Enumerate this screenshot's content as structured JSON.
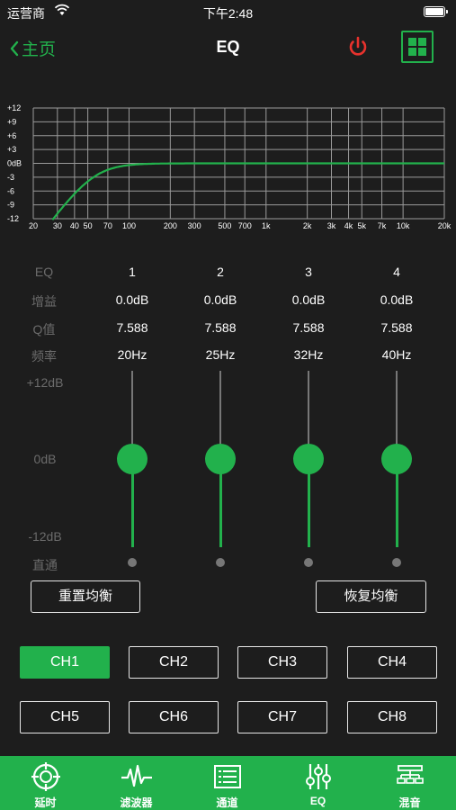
{
  "status_bar": {
    "carrier": "运营商",
    "time": "下午2:48"
  },
  "nav": {
    "back_label": "主页",
    "title": "EQ"
  },
  "eq_graph": {
    "y_ticks": [
      "+12",
      "+9",
      "+6",
      "+3",
      "0dB",
      "-3",
      "-6",
      "-9",
      "-12"
    ],
    "x_ticks": [
      "20",
      "30",
      "40",
      "50",
      "70",
      "100",
      "200",
      "300",
      "500",
      "700",
      "1k",
      "2k",
      "3k",
      "4k",
      "5k",
      "7k",
      "10k",
      "20k"
    ],
    "curve_color": "#22b14c"
  },
  "params": {
    "labels": {
      "eq": "EQ",
      "gain": "增益",
      "q": "Q值",
      "freq": "频率"
    },
    "bands": [
      {
        "eq": "1",
        "gain": "0.0dB",
        "q": "7.588",
        "freq": "20Hz"
      },
      {
        "eq": "2",
        "gain": "0.0dB",
        "q": "7.588",
        "freq": "25Hz"
      },
      {
        "eq": "3",
        "gain": "0.0dB",
        "q": "7.588",
        "freq": "32Hz"
      },
      {
        "eq": "4",
        "gain": "0.0dB",
        "q": "7.588",
        "freq": "40Hz"
      }
    ]
  },
  "sliders": {
    "max_label": "+12dB",
    "mid_label": "0dB",
    "min_label": "-12dB",
    "bypass_label": "直通",
    "levels_db": [
      0,
      0,
      0,
      0
    ]
  },
  "actions": {
    "reset": "重置均衡",
    "restore": "恢复均衡"
  },
  "channels": {
    "items": [
      "CH1",
      "CH2",
      "CH3",
      "CH4",
      "CH5",
      "CH6",
      "CH7",
      "CH8"
    ],
    "selected": "CH1"
  },
  "tabs": [
    {
      "label": "延时",
      "icon": "crosshair-icon"
    },
    {
      "label": "滤波器",
      "icon": "waveform-icon"
    },
    {
      "label": "通道",
      "icon": "list-icon"
    },
    {
      "label": "EQ",
      "icon": "sliders-icon"
    },
    {
      "label": "混音",
      "icon": "network-icon"
    }
  ],
  "colors": {
    "accent": "#22b14c",
    "power": "#e8322d",
    "background": "#1d1d1d"
  }
}
